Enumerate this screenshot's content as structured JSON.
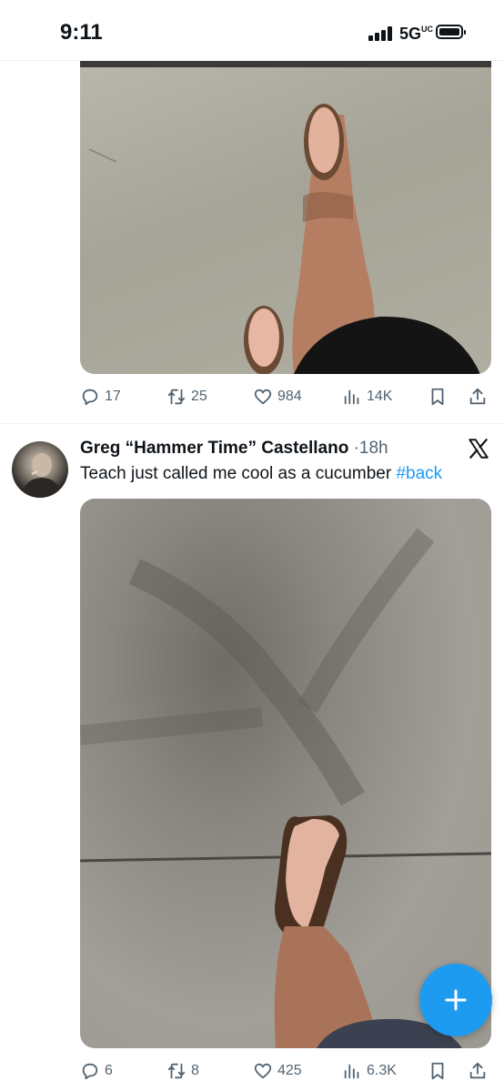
{
  "status_bar": {
    "time": "9:11",
    "network": "5G",
    "network_sup": "UC"
  },
  "tweets": [
    {
      "media_alt": "",
      "actions": {
        "replies": "17",
        "retweets": "25",
        "likes": "984",
        "views": "14K"
      }
    },
    {
      "author": "Greg “Hammer Time” Castellano",
      "separator": "·",
      "time": "18h",
      "text": "Teach just called me cool as a cucumber ",
      "hashtag": "#back",
      "actions": {
        "replies": "6",
        "retweets": "8",
        "likes": "425",
        "views": "6.3K"
      }
    }
  ],
  "icons": {
    "reply": "reply-icon",
    "retweet": "retweet-icon",
    "like": "heart-icon",
    "views": "views-icon",
    "bookmark": "bookmark-icon",
    "share": "share-icon",
    "platform": "x-logo-icon",
    "compose": "plus-icon"
  },
  "colors": {
    "accent": "#1d9bf0",
    "muted": "#536471",
    "text": "#0f1419"
  }
}
